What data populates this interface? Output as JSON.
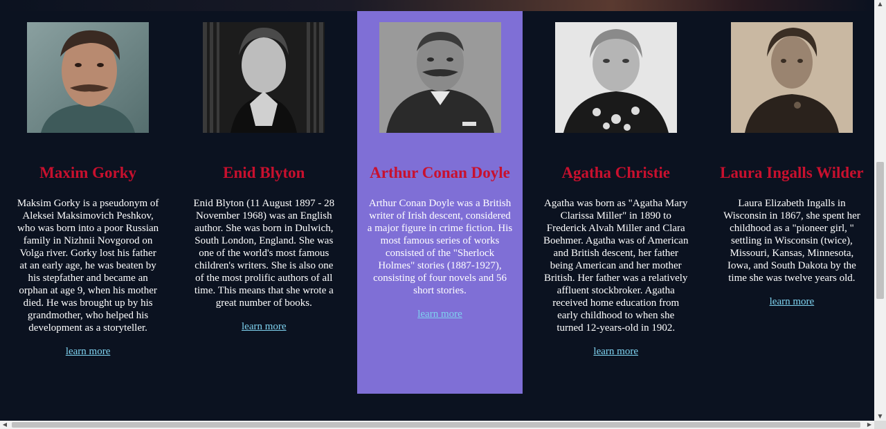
{
  "authors": [
    {
      "name": "Maxim Gorky",
      "bio": "Maksim Gorky is a pseudonym of Aleksei Maksimovich Peshkov, who was born into a poor Russian family in Nizhnii Novgorod on Volga river. Gorky lost his father at an early age, he was beaten by his stepfather and became an orphan at age 9, when his mother died. He was brought up by his grandmother, who helped his development as a storyteller.",
      "link": "learn more",
      "photo": "portrait-photo-color"
    },
    {
      "name": "Enid Blyton",
      "bio": "Enid Blyton (11 August 1897 - 28 November 1968) was an English author. She was born in Dulwich, South London, England. She was one of the world's most famous children's writers. She is also one of the most prolific authors of all time. This means that she wrote a great number of books.",
      "link": "learn more",
      "photo": "portrait-photo-bw"
    },
    {
      "name": "Arthur Conan Doyle",
      "bio": "Arthur Conan Doyle was a British writer of Irish descent, considered a major figure in crime fiction. His most famous series of works consisted of the \"Sherlock Holmes\" stories (1887-1927), consisting of four novels and 56 short stories.",
      "link": "learn more",
      "photo": "portrait-photo-bw"
    },
    {
      "name": "Agatha Christie",
      "bio": "Agatha was born as \"Agatha Mary Clarissa Miller\" in 1890 to Frederick Alvah Miller and Clara Boehmer. Agatha was of American and British descent, her father being American and her mother British. Her father was a relatively affluent stockbroker. Agatha received home education from early childhood to when she turned 12-years-old in 1902.",
      "link": "learn more",
      "photo": "portrait-photo-bw"
    },
    {
      "name": "Laura Ingalls Wilder",
      "bio": "Laura Elizabeth Ingalls in Wisconsin in 1867, she spent her childhood as a \"pioneer girl, \" settling in Wisconsin (twice), Missouri, Kansas, Minnesota, Iowa, and South Dakota by the time she was twelve years old.",
      "link": "learn more",
      "photo": "portrait-photo-sepia"
    }
  ],
  "colors": {
    "background": "#0b1220",
    "active_card": "#7f6fd6",
    "name": "#c8102e",
    "link": "#7fd3f0"
  }
}
